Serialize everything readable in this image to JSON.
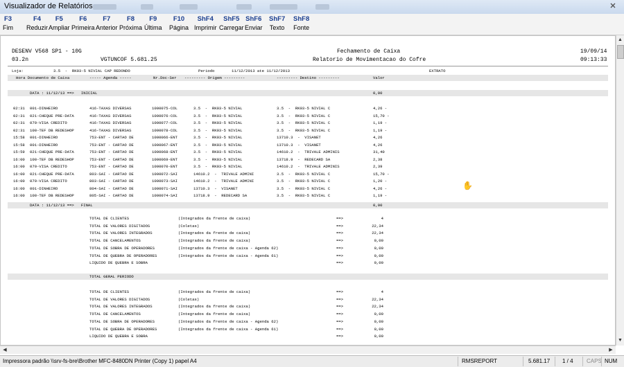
{
  "window": {
    "title": "Visualizador de Relatórios"
  },
  "toolbar": {
    "keys": [
      {
        "key": "F3",
        "label": "Fim"
      },
      {
        "key": "F4",
        "label": "Reduzir"
      },
      {
        "key": "F5",
        "label": "Ampliar"
      },
      {
        "key": "F6",
        "label": "Primeira"
      },
      {
        "key": "F7",
        "label": "Anterior"
      },
      {
        "key": "F8",
        "label": "Próxima"
      },
      {
        "key": "F9",
        "label": "Última"
      },
      {
        "key": "F10",
        "label": "Página"
      },
      {
        "key": "ShF4",
        "label": "Imprimir"
      },
      {
        "key": "ShF5",
        "label": "Carregar"
      },
      {
        "key": "ShF6",
        "label": "Enviar"
      },
      {
        "key": "ShF7",
        "label": "Texto"
      },
      {
        "key": "ShF8",
        "label": "Fonte"
      }
    ]
  },
  "report": {
    "header": {
      "left1": "DESENV V568 SP1 - 10G",
      "center1": "Fechamento de Caixa",
      "right1": "19/09/14",
      "left2": "03.2n",
      "mid2": "VGTUNCOF 5.681.25",
      "center2": "Relatorio de Movimentacao do Cofre",
      "right2": "09:13:33"
    },
    "filter": {
      "loja_label": "Loja:",
      "loja_value": "3.5  -  RK03-5 NIVIAL CAP REDONDO",
      "periodo_label": "Periodo",
      "periodo_value": "11/12/2013 ate 11/12/2013",
      "tipo": "EXTRATO"
    },
    "columns": {
      "hora_doc": "Hora Documento de Caixa",
      "agenda": "----- Agenda -----",
      "nrdoc": "Nr.Doc-Ser",
      "origem": "--------- Origem ---------",
      "destino": "--------- Destino ---------",
      "valor": "Valor"
    },
    "initial_band": {
      "label": "DATA : 11/12/13 ==>   INICIAL",
      "valor": "0,00"
    },
    "rows": [
      {
        "hora": "02:31",
        "doc": "001-DINHEIRO",
        "agenda": "416-TAXAS DIVERSAS",
        "nrdoc": "1000075-COL",
        "origem": "3.5  -  RK03-5 NIVIAL",
        "destino": "3.5  -  RK03-5 NIVIAL C",
        "valor": "4,26 -"
      },
      {
        "hora": "02:31",
        "doc": "021-CHEQUE PRE-DATA",
        "agenda": "416-TAXAS DIVERSAS",
        "nrdoc": "1000076-COL",
        "origem": "3.5  -  RK03-5 NIVIAL",
        "destino": "3.5  -  RK03-5 NIVIAL C",
        "valor": "15,70 -"
      },
      {
        "hora": "02:31",
        "doc": "079-VISA CREDITO",
        "agenda": "416-TAXAS DIVERSAS",
        "nrdoc": "1000077-COL",
        "origem": "3.5  -  RK03-5 NIVIAL",
        "destino": "3.5  -  RK03-5 NIVIAL C",
        "valor": "1,19 -"
      },
      {
        "hora": "02:31",
        "doc": "100-TEF DB REDESHOP",
        "agenda": "416-TAXAS DIVERSAS",
        "nrdoc": "1000078-COL",
        "origem": "3.5  -  RK03-5 NIVIAL",
        "destino": "3.5  -  RK03-5 NIVIAL C",
        "valor": "1,19 -"
      },
      {
        "hora": "15:58",
        "doc": "001-DINHEIRO",
        "agenda": "753-ENT - CARTAO DE",
        "nrdoc": "1000066-ENT",
        "origem": "3.5  -  RK03-5 NIVIAL",
        "destino": "13710.3  -  VISANET",
        "valor": "4,26"
      },
      {
        "hora": "15:58",
        "doc": "001-DINHEIRO",
        "agenda": "753-ENT - CARTAO DE",
        "nrdoc": "1000067-ENT",
        "origem": "3.5  -  RK03-5 NIVIAL",
        "destino": "13710.3  -  VISANET",
        "valor": "4,26"
      },
      {
        "hora": "15:59",
        "doc": "021-CHEQUE PRE-DATA",
        "agenda": "753-ENT - CARTAO DE",
        "nrdoc": "1000068-ENT",
        "origem": "3.5  -  RK03-5 NIVIAL",
        "destino": "14610.2  -  TRIVALE ADMINIS",
        "valor": "31,40"
      },
      {
        "hora": "16:00",
        "doc": "100-TEF DB REDESHOP",
        "agenda": "753-ENT - CARTAO DE",
        "nrdoc": "1000069-ENT",
        "origem": "3.5  -  RK03-5 NIVIAL",
        "destino": "13718.9  -  REDECARD SA",
        "valor": "2,38"
      },
      {
        "hora": "16:00",
        "doc": "079-VISA CREDITO",
        "agenda": "753-ENT - CARTAO DE",
        "nrdoc": "1000070-ENT",
        "origem": "3.5  -  RK03-5 NIVIAL",
        "destino": "14610.2  -  TRIVALE ADMINIS",
        "valor": "2,39"
      },
      {
        "hora": "16:00",
        "doc": "021-CHEQUE PRE-DATA",
        "agenda": "803-SAI - CARTAO DE",
        "nrdoc": "1000072-SAI",
        "origem": "14610.2  -  TRIVALE ADMINI",
        "destino": "3.5  -  RK03-5 NIVIAL C",
        "valor": "15,70 -"
      },
      {
        "hora": "16:00",
        "doc": "079-VISA CREDITO",
        "agenda": "803-SAI - CARTAO DE",
        "nrdoc": "1000073-SAI",
        "origem": "14610.2  -  TRIVALE ADMINI",
        "destino": "3.5  -  RK03-5 NIVIAL C",
        "valor": "1,20 -"
      },
      {
        "hora": "16:00",
        "doc": "001-DINHEIRO",
        "agenda": "804-SAI - CARTAO DE",
        "nrdoc": "1000071-SAI",
        "origem": "13710.3  -  VISANET",
        "destino": "3.5  -  RK03-5 NIVIAL C",
        "valor": "4,26 -"
      },
      {
        "hora": "16:00",
        "doc": "100-TEF DB REDESHOP",
        "agenda": "805-SAI - CARTAO DE",
        "nrdoc": "1000074-SAI",
        "origem": "13718.9  -  REDECARD SA",
        "destino": "3.5  -  RK03-5 NIVIAL C",
        "valor": "1,19 -"
      }
    ],
    "final_band": {
      "label": "DATA : 11/12/13 ==>   FINAL",
      "valor": "0,00"
    },
    "totals1": [
      {
        "label": "TOTAL DE CLIENTES",
        "note": "(Integrados da frente de caixa)",
        "arrow": "==>",
        "valor": "4"
      },
      {
        "label": "TOTAL DE VALORES DIGITADOS",
        "note": "(Coletas)",
        "arrow": "==>",
        "valor": "22,34"
      },
      {
        "label": "TOTAL DE VALORES INTEGRADOS",
        "note": "(Integrados da frente de caixa)",
        "arrow": "==>",
        "valor": "22,34"
      },
      {
        "label": "TOTAL DE CANCELAMENTOS",
        "note": "(Integrados da frente de caixa)",
        "arrow": "==>",
        "valor": "0,00"
      },
      {
        "label": "TOTAL DE SOBRA DE OPERADORES",
        "note": "(Integrados da frente de caixa - Agenda 62)",
        "arrow": "==>",
        "valor": "0,00"
      },
      {
        "label": "TOTAL DE QUEBRA DE OPERADORES",
        "note": "(Integrados da frente de caixa - Agenda 61)",
        "arrow": "==>",
        "valor": "0,00"
      },
      {
        "label": "LIQUIDO DE QUEBRA E SOBRA",
        "note": "",
        "arrow": "==>",
        "valor": "0,00"
      }
    ],
    "general_band": {
      "label": "TOTAL GERAL PERIODO"
    },
    "totals2": [
      {
        "label": "TOTAL DE CLIENTES",
        "note": "(Integrados da frente de caixa)",
        "arrow": "==>",
        "valor": "4"
      },
      {
        "label": "TOTAL DE VALORES DIGITADOS",
        "note": "(Coletas)",
        "arrow": "==>",
        "valor": "22,34"
      },
      {
        "label": "TOTAL DE VALORES INTEGRADOS",
        "note": "(Integrados da frente de caixa)",
        "arrow": "==>",
        "valor": "22,34"
      },
      {
        "label": "TOTAL DE CANCELAMENTOS",
        "note": "(Integrados da frente de caixa)",
        "arrow": "==>",
        "valor": "0,00"
      },
      {
        "label": "TOTAL DE SOBRA DE OPERADORES",
        "note": "(Integrados da frente de caixa - Agenda 62)",
        "arrow": "==>",
        "valor": "0,00"
      },
      {
        "label": "TOTAL DE QUEBRA DE OPERADORES",
        "note": "(Integrados da frente de caixa - Agenda 61)",
        "arrow": "==>",
        "valor": "0,00"
      },
      {
        "label": "LIQUIDO DE QUEBRA E SOBRA",
        "note": "",
        "arrow": "==>",
        "valor": "0,00"
      }
    ]
  },
  "status": {
    "printer": "Impressora padrão \\\\srv-fs-bre\\Brother MFC-8480DN Printer (Copy 1) papel A4",
    "module": "RMSREPORT",
    "version": "5.681.17",
    "page": "1 / 4",
    "caps": "CAPS",
    "num": "NUM"
  }
}
